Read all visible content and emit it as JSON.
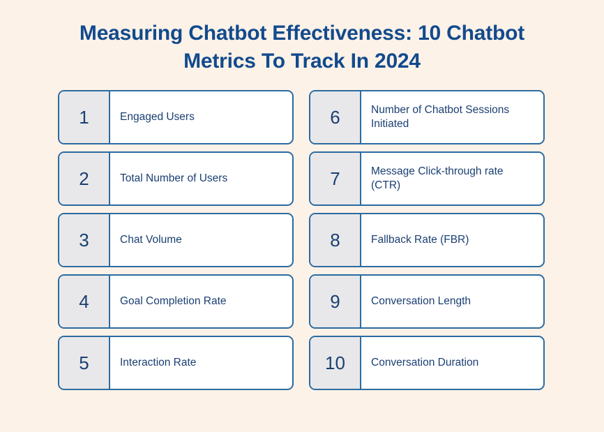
{
  "colors": {
    "background": "#FDF2E8",
    "title_text": "#124A8D",
    "card_border": "#2C6BA0",
    "number_box_fill": "#E8E8EA",
    "label_text": "#1B3F72",
    "card_fill": "#FFFFFF"
  },
  "title": {
    "full": "Measuring Chatbot Effectiveness: 10 Chatbot Metrics To Track In 2024",
    "line1": "Measuring Chatbot Effectiveness: 10 Chatbot",
    "line2": "Metrics To Track In 2024"
  },
  "metrics": [
    {
      "number": "1",
      "label": "Engaged Users"
    },
    {
      "number": "6",
      "label": "Number of Chatbot Sessions Initiated"
    },
    {
      "number": "2",
      "label": "Total Number of Users"
    },
    {
      "number": "7",
      "label": "Message Click-through rate (CTR)"
    },
    {
      "number": "3",
      "label": "Chat Volume"
    },
    {
      "number": "8",
      "label": "Fallback Rate (FBR)"
    },
    {
      "number": "4",
      "label": "Goal Completion Rate"
    },
    {
      "number": "9",
      "label": "Conversation Length"
    },
    {
      "number": "5",
      "label": "Interaction Rate"
    },
    {
      "number": "10",
      "label": "Conversation Duration"
    }
  ]
}
